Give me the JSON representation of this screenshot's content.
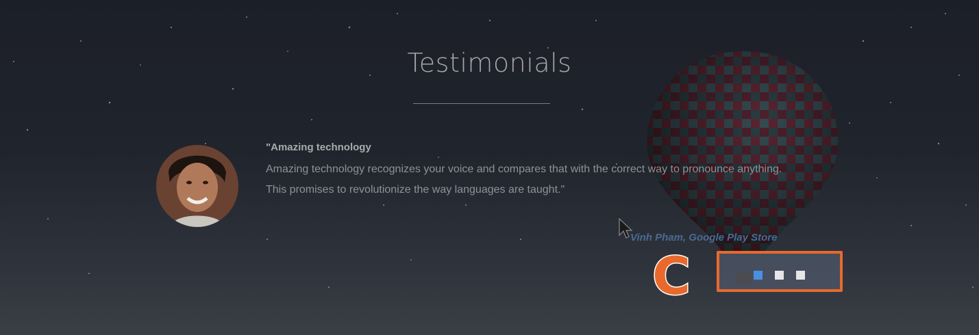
{
  "section": {
    "title": "Testimonials"
  },
  "testimonial": {
    "quote_title": "\"Amazing technology",
    "quote_body": "Amazing technology recognizes your voice and compares that with the correct way to pronounce anything. This promises to revolutionize the way languages are taught.\"",
    "author": "Vinh Pham, Google Play Store"
  },
  "annotation": {
    "marker_label": "C"
  },
  "carousel": {
    "dots": [
      {
        "state": "active",
        "color": "#4a90e2"
      },
      {
        "state": "inactive",
        "color": "#e6e6e6"
      },
      {
        "state": "inactive",
        "color": "#e6e6e6"
      }
    ]
  },
  "colors": {
    "background": "#20242c",
    "annotation_orange": "#e9692c",
    "author_link": "#4a6a92"
  },
  "icons": {
    "cursor": "mouse-pointer-icon",
    "avatar": "user-photo"
  }
}
